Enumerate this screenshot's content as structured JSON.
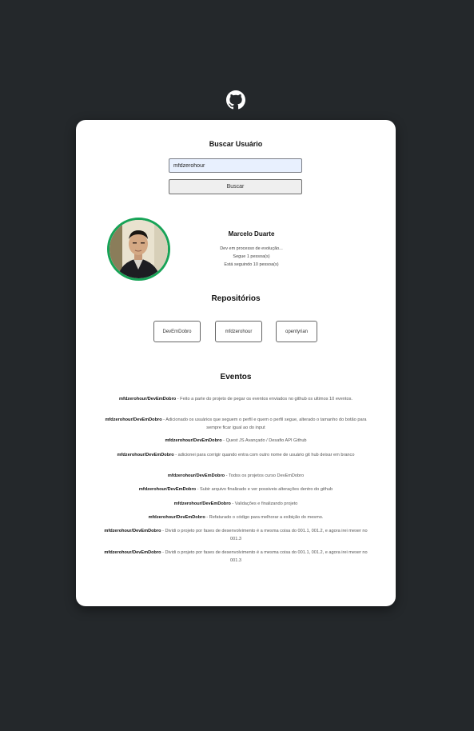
{
  "header": {
    "logo_icon": "github-icon"
  },
  "search": {
    "title": "Buscar Usuário",
    "input_value": "mfdzerohour",
    "button_label": "Buscar"
  },
  "profile": {
    "avatar_icon": "profile-photo",
    "name": "Marcelo Duarte",
    "bio": "Dev em processo de evolução...",
    "followers": "Segue 1 pessoa(s)",
    "following": "Está seguindo 10 pessoa(s)"
  },
  "repositories": {
    "title": "Repositórios",
    "items": [
      "DevEmDobro",
      "mfdzerohour",
      "opentyrian"
    ]
  },
  "events": {
    "title": "Eventos",
    "items": [
      {
        "repo": "mfdzerohour/DevEmDobro",
        "message": " - Feito a parte do projeto de pegar os eventos enviados no github os ultimos 10 eventos."
      },
      {
        "repo": "mfdzerohour/DevEmDobro",
        "message": " - Adicionado os usuários que seguem o perfil e quem o perfil segue, alterado o tamanho do botão para sempre ficar igual ao do input"
      },
      {
        "repo": "mfdzerohour/DevEmDobro",
        "message": " - Quest JS Avançado / Desafio API Github"
      },
      {
        "repo": "mfdzerohour/DevEmDobro",
        "message": " - adicionei para corrigir quando entra com outro nome de usuário git hub deixar em branco"
      },
      {
        "repo": "mfdzerohour/DevEmDobro",
        "message": " - Todos os projetos curso DevEmDobro"
      },
      {
        "repo": "mfdzerohour/DevEmDobro",
        "message": " - Subir arquivo finalizado e ver possiveis alterações dentro do github"
      },
      {
        "repo": "mfdzerohour/DevEmDobro",
        "message": " - Validações e finalizando projeto"
      },
      {
        "repo": "mfdzerohour/DevEmDobro",
        "message": " - Refaturado o código para melhorar a exibição do mesmo."
      },
      {
        "repo": "mfdzerohour/DevEmDobro",
        "message": " - Dividi o projeto por fases de desenvolvimento é a mesma coisa do 001.1, 001.2, e agora irei mexer no 001.3"
      },
      {
        "repo": "mfdzerohour/DevEmDobro",
        "message": " - Dividi o projeto por fases de desenvolvimento é a mesma coisa do 001.1, 001.2, e agora irei mexer no 001.3"
      }
    ]
  },
  "colors": {
    "background": "#24282b",
    "card": "#ffffff",
    "avatar_border": "#17a357",
    "input_background": "#e8f0fe"
  }
}
